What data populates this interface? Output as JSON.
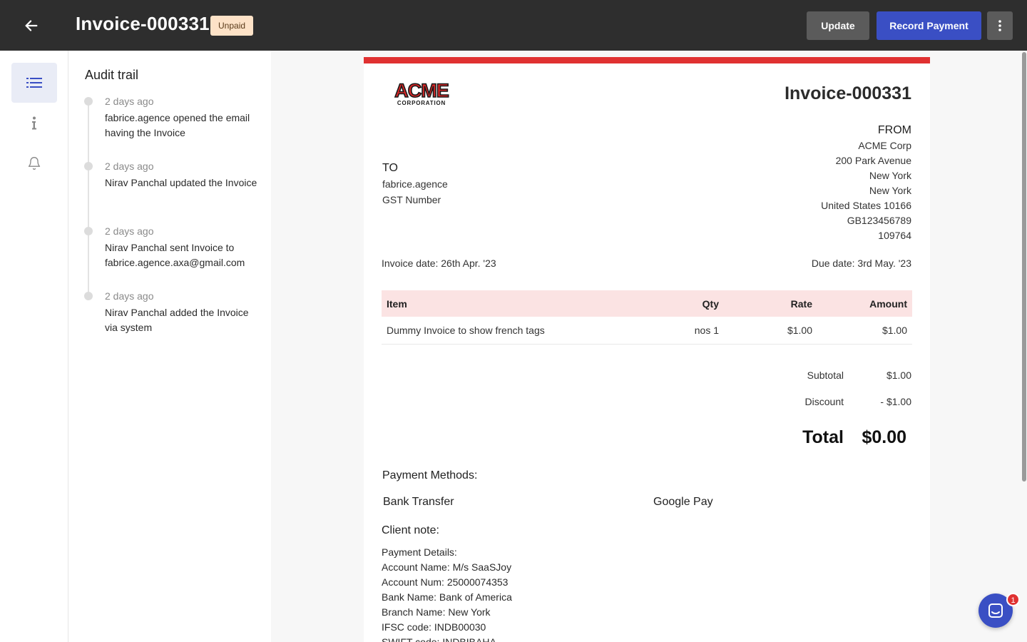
{
  "header": {
    "title": "Invoice-000331",
    "status_badge": "Unpaid",
    "update_label": "Update",
    "record_payment_label": "Record Payment"
  },
  "audit": {
    "title": "Audit trail",
    "events": [
      {
        "time": "2 days ago",
        "text": "fabrice.agence opened the email having the Invoice"
      },
      {
        "time": "2 days ago",
        "text": "Nirav Panchal updated the Invoice"
      },
      {
        "time": "2 days ago",
        "text": "Nirav Panchal sent Invoice to fabrice.agence.axa@gmail.com"
      },
      {
        "time": "2 days ago",
        "text": "Nirav Panchal added the Invoice via system"
      }
    ]
  },
  "invoice": {
    "logo_text": "ACME",
    "logo_subtext": "CORPORATION",
    "title": "Invoice-000331",
    "from": {
      "heading": "FROM",
      "lines": [
        "ACME Corp",
        "200 Park Avenue",
        "New York",
        "New York",
        "United States 10166",
        "GB123456789",
        "109764"
      ]
    },
    "to": {
      "heading": "TO",
      "lines": [
        "fabrice.agence",
        "GST Number"
      ]
    },
    "invoice_date": "Invoice date: 26th Apr. '23",
    "due_date": "Due date: 3rd May. '23",
    "columns": {
      "item": "Item",
      "qty": "Qty",
      "rate": "Rate",
      "amount": "Amount"
    },
    "rows": [
      {
        "item": "Dummy Invoice to show french tags",
        "qty": "nos 1",
        "rate": "$1.00",
        "amount": "$1.00"
      }
    ],
    "subtotal_label": "Subtotal",
    "subtotal_value": "$1.00",
    "discount_label": "Discount",
    "discount_value": "- $1.00",
    "total_label": "Total",
    "total_value": "$0.00",
    "payment_methods_title": "Payment Methods:",
    "payment_methods": [
      "Bank Transfer",
      "Google Pay"
    ],
    "client_note_title": "Client note:",
    "client_note_lines": [
      "Payment Details:",
      "Account Name: M/s SaaSJoy",
      "Account Num: 25000074353",
      "Bank Name: Bank of America",
      "Branch Name: New York",
      "IFSC code: INDB00030",
      "SWIFT code: INDBIBAHA"
    ]
  },
  "chat": {
    "unread_count": "1"
  },
  "colors": {
    "topbar": "#2e2e2e",
    "primary": "#3a4fc4",
    "accent_bar": "#e03131",
    "badge_bg": "#fde2c7",
    "table_header": "#fbe3e3"
  }
}
